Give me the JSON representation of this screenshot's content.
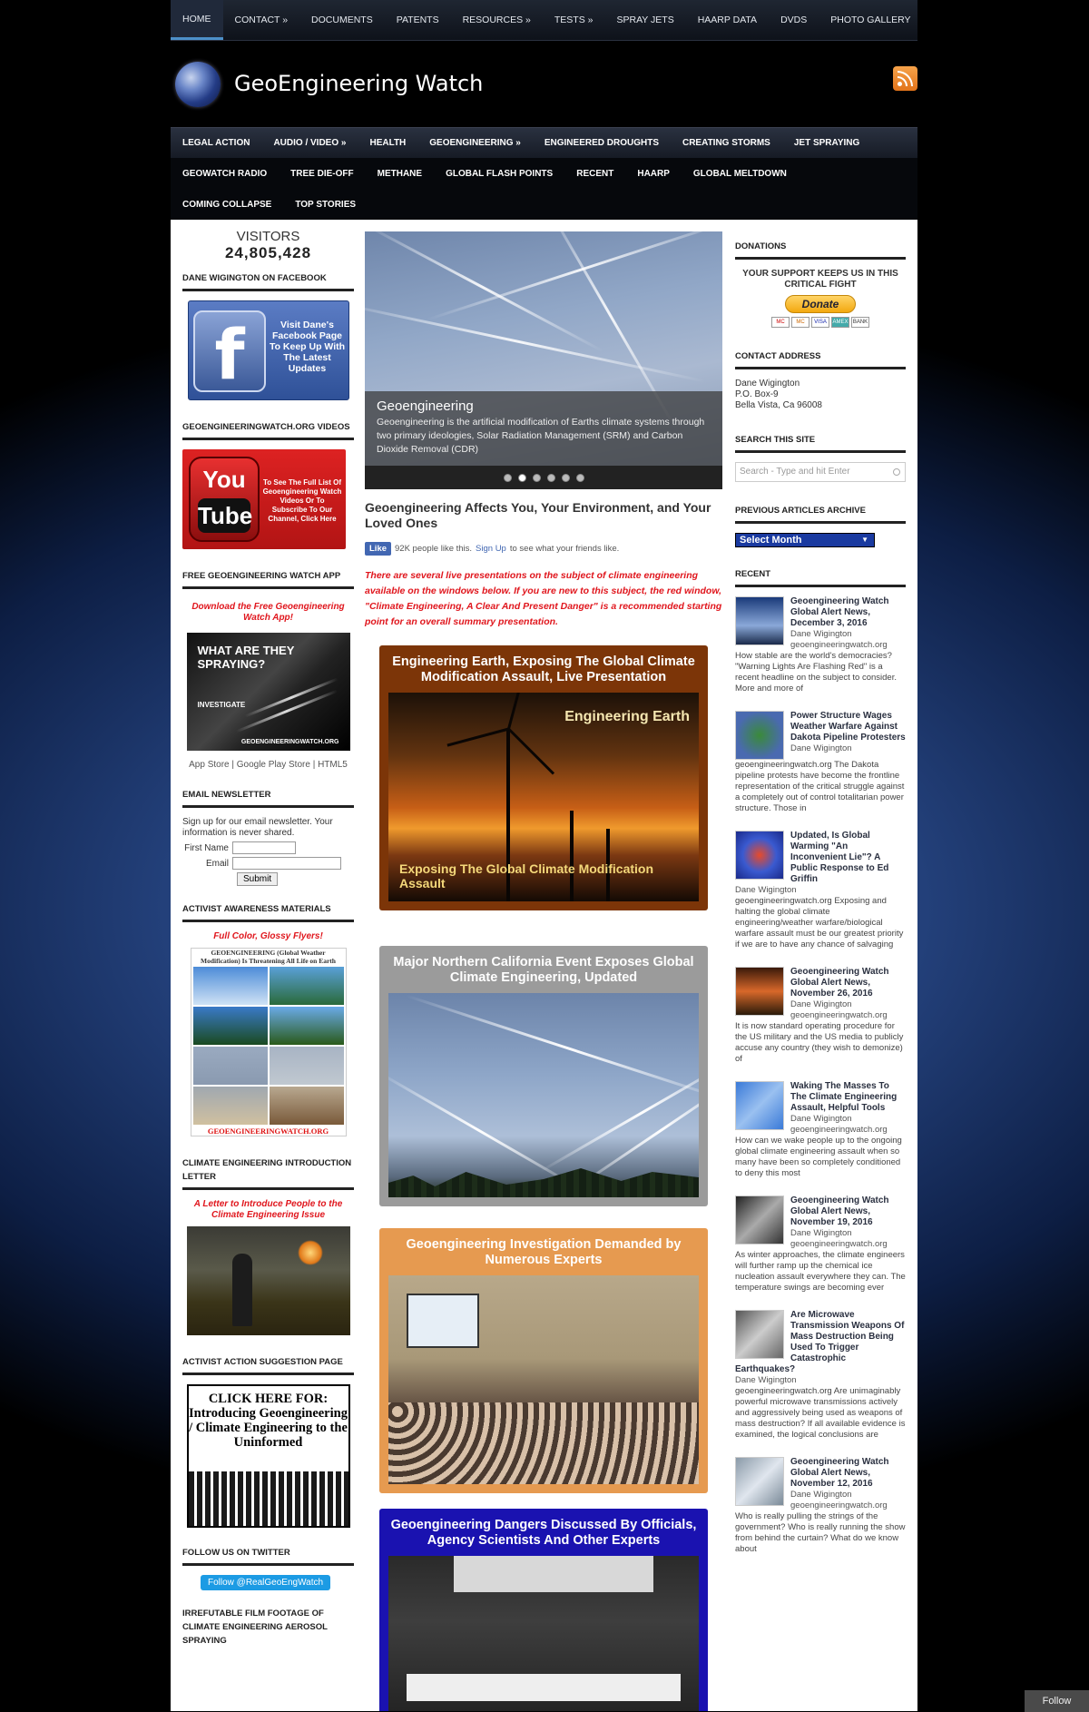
{
  "topnav": [
    {
      "label": "HOME"
    },
    {
      "label": "CONTACT »"
    },
    {
      "label": "DOCUMENTS"
    },
    {
      "label": "PATENTS"
    },
    {
      "label": "RESOURCES »"
    },
    {
      "label": "TESTS »"
    },
    {
      "label": "SPRAY JETS"
    },
    {
      "label": "HAARP DATA"
    },
    {
      "label": "DVDS"
    },
    {
      "label": "PHOTO GALLERY"
    }
  ],
  "site": {
    "title": "GeoEngineering Watch"
  },
  "mainnav": {
    "row1": [
      "LEGAL ACTION",
      "AUDIO / VIDEO »",
      "HEALTH",
      "GEOENGINEERING »",
      "ENGINEERED DROUGHTS",
      "CREATING STORMS",
      "JET SPRAYING"
    ],
    "row2": [
      "GEOWATCH RADIO",
      "TREE DIE-OFF",
      "METHANE",
      "GLOBAL FLASH POINTS",
      "RECENT",
      "HAARP",
      "GLOBAL MELTDOWN"
    ],
    "row3": [
      "COMING COLLAPSE",
      "TOP STORIES"
    ]
  },
  "left": {
    "visitors_label": "VISITORS",
    "visitors_count": "24,805,428",
    "fb_title": "DANE WIGINGTON ON FACEBOOK",
    "fb_text": "Visit Dane's Facebook Page To Keep Up With The Latest Updates",
    "yt_title": "GEOENGINEERINGWATCH.ORG VIDEOS",
    "yt_you": "You",
    "yt_tube": "Tube",
    "yt_text": "To See The Full List Of Geoengineering Watch Videos Or To Subscribe To Our Channel, Click Here",
    "app_title": "FREE GEOENGINEERING WATCH APP",
    "app_download": "Download the Free Geoengineering Watch App!",
    "app_img_t1": "WHAT ARE THEY SPRAYING?",
    "app_img_t2": "INVESTIGATE",
    "app_img_t3": "GEOENGINEERINGWATCH.ORG",
    "app_links": "App Store | Google Play Store | HTML5",
    "nl_title": "EMAIL NEWSLETTER",
    "nl_text": "Sign up for our email newsletter. Your information is never shared.",
    "nl_first": "First Name",
    "nl_email": "Email",
    "nl_submit": "Submit",
    "act_title": "ACTIVIST AWARENESS MATERIALS",
    "act_sub": "Full Color, Glossy Flyers!",
    "poster_head": "GEOENGINEERING (Global Weather Modification) Is Threatening All Life on Earth",
    "poster_foot": "GEOENGINEERINGWATCH.ORG",
    "letter_title": "CLIMATE ENGINEERING INTRODUCTION LETTER",
    "letter_sub": "A Letter to Introduce People to the Climate Engineering Issue",
    "action_title": "ACTIVIST ACTION SUGGESTION PAGE",
    "action_box": "CLICK HERE FOR: Introducing Geoengineering / Climate Engineering to the Uninformed",
    "tw_title": "FOLLOW US ON TWITTER",
    "tw_btn": "Follow @RealGeoEngWatch",
    "film_title": "IRREFUTABLE FILM FOOTAGE OF CLIMATE ENGINEERING AEROSOL SPRAYING"
  },
  "center": {
    "slider": {
      "title": "Geoengineering",
      "desc": "Geoengineering is the artificial modification of Earths climate systems through two primary ideologies, Solar Radiation Management (SRM) and Carbon Dioxide Removal (CDR)"
    },
    "heading": "Geoengineering Affects You, Your Environment, and Your Loved Ones",
    "fb_like": "Like",
    "fb_count": "92K people like this.",
    "fb_signup": "Sign Up",
    "fb_rest": "to see what your friends like.",
    "intro": "There are several live presentations on the subject of climate engineering available on the windows below. If you are new to this subject, the red window, \"Climate Engineering, A Clear And Present Danger\" is a recommended starting point for an overall summary presentation.",
    "features": [
      {
        "title": "Engineering Earth, Exposing The Global Climate Modification Assault, Live Presentation",
        "img_top": "Engineering Earth",
        "img_bottom": "Exposing The Global Climate Modification Assault",
        "color": "#7c3508"
      },
      {
        "title": "Major Northern California Event Exposes Global Climate Engineering, Updated",
        "color": "#9b9b9b"
      },
      {
        "title": "Geoengineering Investigation Demanded by Numerous Experts",
        "color": "#e69a50"
      },
      {
        "title": "Geoengineering Dangers Discussed By Officials, Agency Scientists And Other Experts",
        "color": "#1a12b0"
      }
    ]
  },
  "right": {
    "don_title": "DONATIONS",
    "don_support": "YOUR SUPPORT KEEPS US IN THIS CRITICAL FIGHT",
    "don_btn": "Donate",
    "don_cards": [
      "MC",
      "MC",
      "VISA",
      "AMEX",
      "BANK"
    ],
    "addr_title": "CONTACT ADDRESS",
    "addr1": "Dane Wigington",
    "addr2": "P.O. Box-9",
    "addr3": "Bella Vista, Ca 96008",
    "search_title": "SEARCH THIS SITE",
    "search_placeholder": "Search - Type and hit Enter",
    "arch_title": "PREVIOUS ARTICLES ARCHIVE",
    "arch_select": "Select Month",
    "recent_title": "RECENT",
    "posts": [
      {
        "title": "Geoengineering Watch Global Alert News, December 3, 2016",
        "by": "Dane Wigington geoengineeringwatch.org",
        "ex": "How stable are the world's democracies? \"Warning Lights Are Flashing Red\" is a recent headline on the subject to consider. More and more of"
      },
      {
        "title": "Power Structure Wages Weather Warfare Against Dakota Pipeline Protesters",
        "by": "Dane Wigington",
        "ex": "geoengineeringwatch.org The Dakota pipeline protests have become the frontline representation of the critical struggle against a completely out of control totalitarian power structure. Those in"
      },
      {
        "title": "Updated, Is Global Warming \"An Inconvenient Lie\"? A Public Response to Ed Griffin",
        "by": "Dane Wigington",
        "ex": "geoengineeringwatch.org Exposing and halting the global climate engineering/weather warfare/biological warfare assault must be our greatest priority if we are to have any chance of salvaging"
      },
      {
        "title": "Geoengineering Watch Global Alert News, November 26, 2016",
        "by": "Dane Wigington geoengineeringwatch.org",
        "ex": "It is now standard operating procedure for the US military and the US media to publicly accuse any country (they wish to demonize) of"
      },
      {
        "title": "Waking The Masses To The Climate Engineering Assault, Helpful Tools",
        "by": "Dane Wigington geoengineeringwatch.org",
        "ex": "How can we wake people up to the ongoing global climate engineering assault when so many have been so completely conditioned to deny this most"
      },
      {
        "title": "Geoengineering Watch Global Alert News, November 19, 2016",
        "by": "Dane Wigington geoengineeringwatch.org",
        "ex": "As winter approaches, the climate engineers will further ramp up the chemical ice nucleation assault everywhere they can. The temperature swings are becoming ever"
      },
      {
        "title": "Are Microwave Transmission Weapons Of Mass Destruction Being Used To Trigger Catastrophic Earthquakes?",
        "by": "Dane Wigington",
        "ex": "geoengineeringwatch.org Are unimaginably powerful microwave transmissions actively and aggressively being used as weapons of mass destruction? If all available evidence is examined, the logical conclusions are"
      },
      {
        "title": "Geoengineering Watch Global Alert News, November 12, 2016",
        "by": "Dane Wigington geoengineeringwatch.org",
        "ex": "Who is really pulling the strings of the government? Who is really running the show from behind the curtain? What do we know about"
      }
    ]
  },
  "follow": "Follow"
}
